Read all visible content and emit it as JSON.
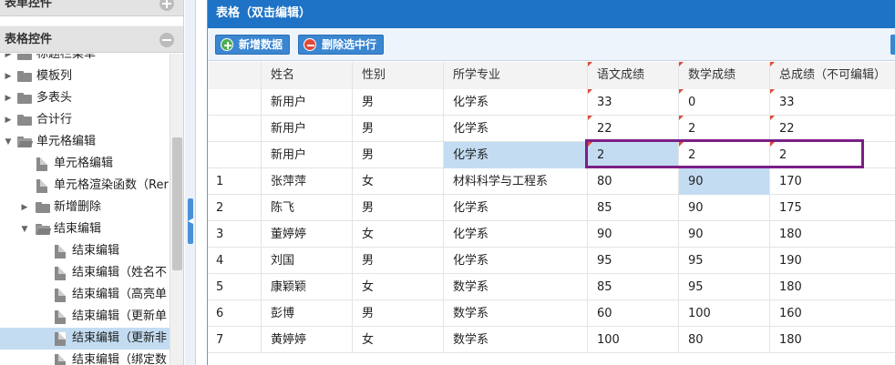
{
  "sidebar": {
    "sections": [
      {
        "title": "表单控件",
        "state": "collapsed",
        "icon": "plus-icon"
      },
      {
        "title": "表格控件",
        "state": "expanded",
        "icon": "minus-icon"
      }
    ],
    "tree": [
      {
        "label": "标题栏菜单",
        "type": "folder",
        "level": 0,
        "expanded": false
      },
      {
        "label": "模板列",
        "type": "folder",
        "level": 0,
        "expanded": false
      },
      {
        "label": "多表头",
        "type": "folder",
        "level": 0,
        "expanded": false
      },
      {
        "label": "合计行",
        "type": "folder",
        "level": 0,
        "expanded": false
      },
      {
        "label": "单元格编辑",
        "type": "folder",
        "level": 0,
        "expanded": true
      },
      {
        "label": "单元格编辑",
        "type": "file",
        "level": 1
      },
      {
        "label": "单元格渲染函数（Rer",
        "type": "file",
        "level": 1
      },
      {
        "label": "新增删除",
        "type": "folder",
        "level": 1,
        "expanded": false
      },
      {
        "label": "结束编辑",
        "type": "folder",
        "level": 1,
        "expanded": true
      },
      {
        "label": "结束编辑",
        "type": "file",
        "level": 2
      },
      {
        "label": "结束编辑（姓名不",
        "type": "file",
        "level": 2
      },
      {
        "label": "结束编辑（高亮单",
        "type": "file",
        "level": 2
      },
      {
        "label": "结束编辑（更新单",
        "type": "file",
        "level": 2
      },
      {
        "label": "结束编辑（更新非",
        "type": "file",
        "level": 2,
        "selected": true
      },
      {
        "label": "结束编辑（绑定数",
        "type": "file",
        "level": 2
      }
    ]
  },
  "panel": {
    "title": "表格（双击编辑）",
    "toolbar": {
      "add_label": "新增数据",
      "delete_label": "删除选中行"
    }
  },
  "grid": {
    "columns": [
      "",
      "姓名",
      "性别",
      "所学专业",
      "语文成绩",
      "数学成绩",
      "总成绩（不可编辑）"
    ],
    "rows": [
      {
        "num": "",
        "name": "新用户",
        "gender": "男",
        "major": "化学系",
        "chinese": "33",
        "math": "0",
        "total": "33"
      },
      {
        "num": "",
        "name": "新用户",
        "gender": "男",
        "major": "化学系",
        "chinese": "22",
        "math": "2",
        "total": "22"
      },
      {
        "num": "",
        "name": "新用户",
        "gender": "男",
        "major": "化学系",
        "chinese": "2",
        "math": "2",
        "total": "2"
      },
      {
        "num": "1",
        "name": "张萍萍",
        "gender": "女",
        "major": "材料科学与工程系",
        "chinese": "80",
        "math": "90",
        "total": "170"
      },
      {
        "num": "2",
        "name": "陈飞",
        "gender": "男",
        "major": "化学系",
        "chinese": "85",
        "math": "90",
        "total": "175"
      },
      {
        "num": "3",
        "name": "董婷婷",
        "gender": "女",
        "major": "化学系",
        "chinese": "90",
        "math": "90",
        "total": "180"
      },
      {
        "num": "4",
        "name": "刘国",
        "gender": "男",
        "major": "化学系",
        "chinese": "95",
        "math": "95",
        "total": "190"
      },
      {
        "num": "5",
        "name": "康颖颖",
        "gender": "女",
        "major": "数学系",
        "chinese": "85",
        "math": "95",
        "total": "180"
      },
      {
        "num": "6",
        "name": "彭博",
        "gender": "男",
        "major": "数学系",
        "chinese": "60",
        "math": "100",
        "total": "160"
      },
      {
        "num": "7",
        "name": "黄婷婷",
        "gender": "女",
        "major": "数学系",
        "chinese": "100",
        "math": "80",
        "total": "180"
      }
    ]
  },
  "colors": {
    "header_blue": "#1e73c6",
    "selection_blue": "#c3dcf2",
    "dirty_marker": "#e04a3a",
    "highlight_box": "#7b1f86"
  }
}
